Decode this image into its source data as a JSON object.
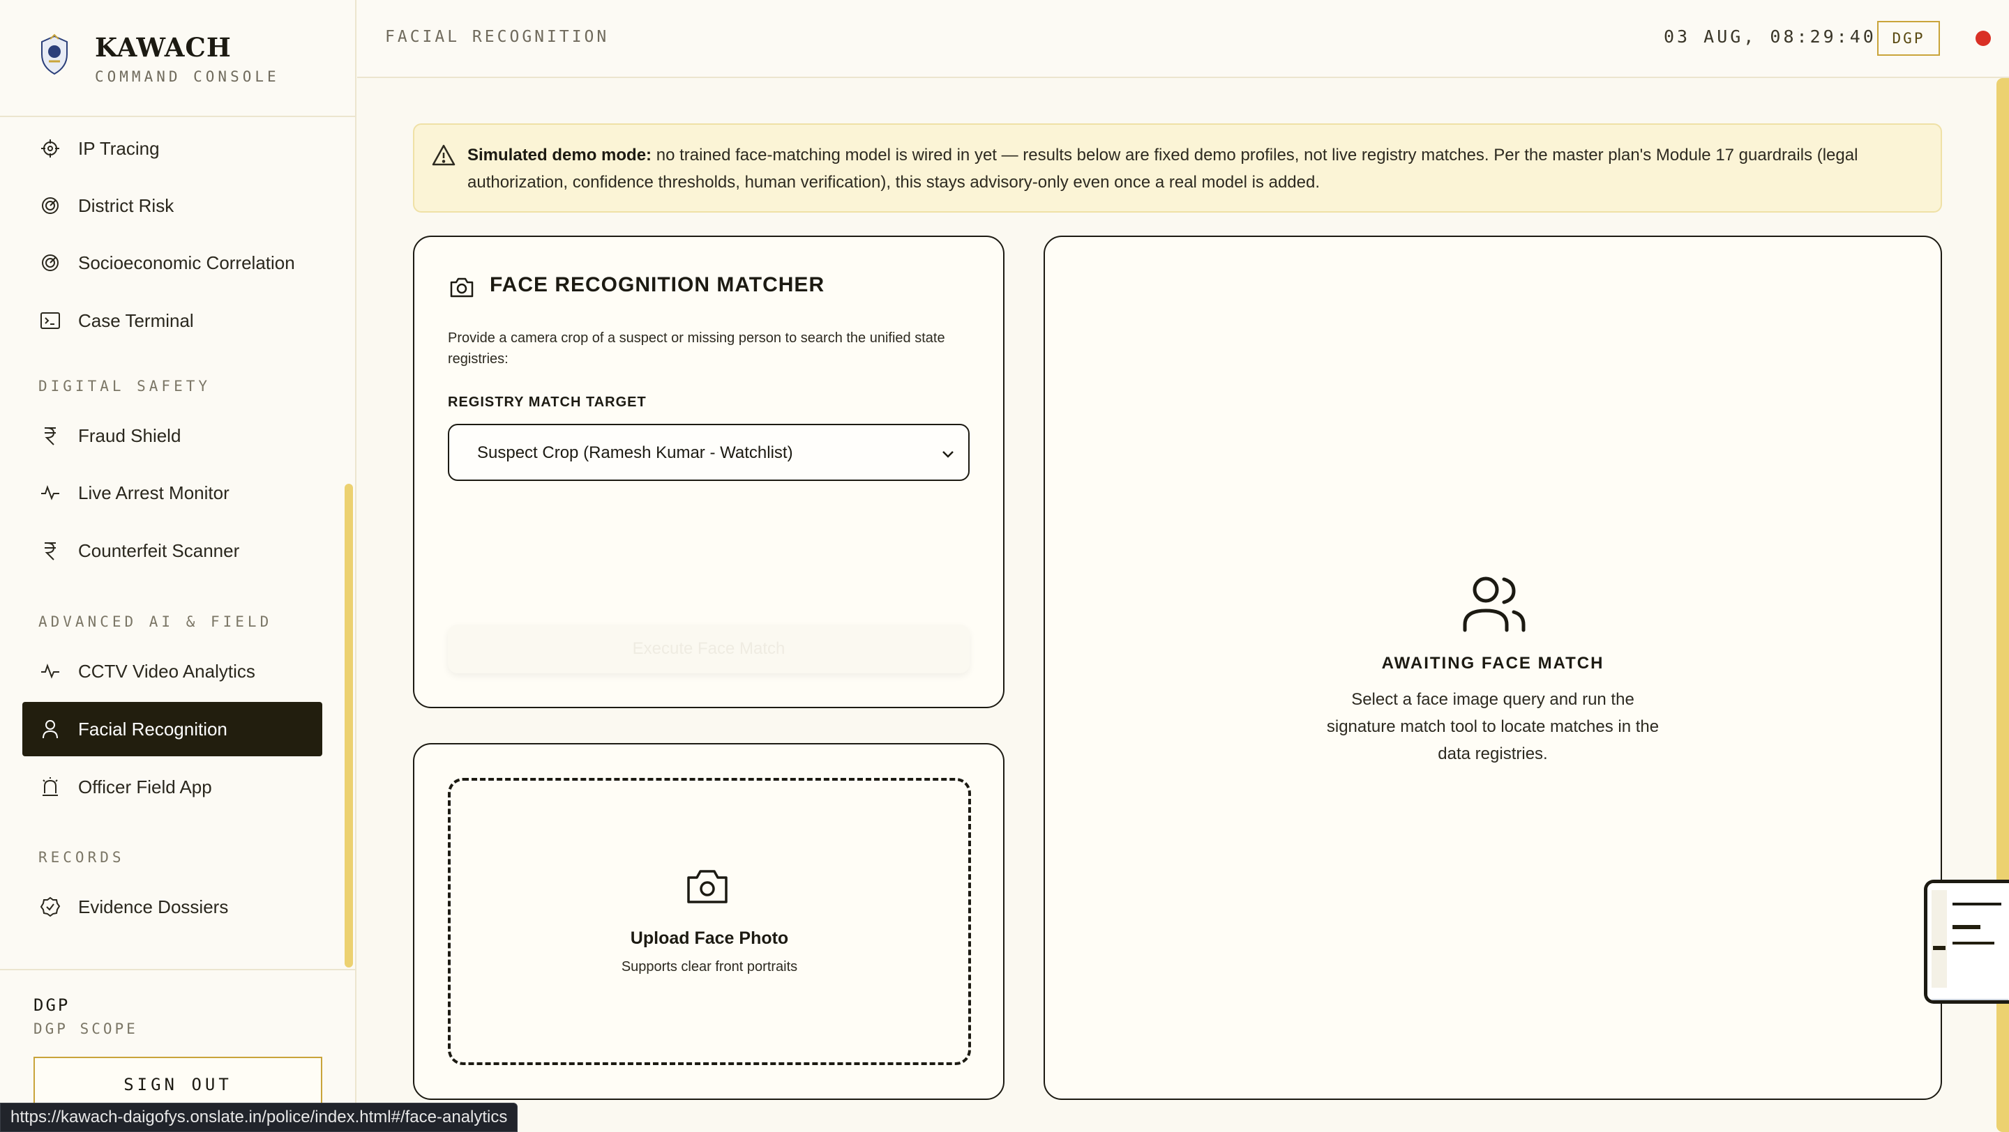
{
  "brand": {
    "title": "KAWACH",
    "subtitle": "COMMAND CONSOLE"
  },
  "nav": {
    "items_top": [
      {
        "label": "IP Tracing",
        "icon": "crosshair-icon"
      },
      {
        "label": "District Risk",
        "icon": "target-icon"
      },
      {
        "label": "Socioeconomic Correlation",
        "icon": "target-icon"
      },
      {
        "label": "Case Terminal",
        "icon": "terminal-icon"
      }
    ],
    "section_digital": "DIGITAL SAFETY",
    "items_digital": [
      {
        "label": "Fraud Shield",
        "icon": "rupee-icon"
      },
      {
        "label": "Live Arrest Monitor",
        "icon": "pulse-icon"
      },
      {
        "label": "Counterfeit Scanner",
        "icon": "rupee-icon"
      }
    ],
    "section_ai": "ADVANCED AI & FIELD",
    "items_ai": [
      {
        "label": "CCTV Video Analytics",
        "icon": "pulse-icon"
      },
      {
        "label": "Facial Recognition",
        "icon": "user-icon",
        "active": true
      },
      {
        "label": "Officer Field App",
        "icon": "siren-icon"
      }
    ],
    "section_records": "RECORDS",
    "items_records": [
      {
        "label": "Evidence Dossiers",
        "icon": "badge-check-icon"
      }
    ]
  },
  "user": {
    "name": "DGP",
    "scope": "DGP SCOPE",
    "signout_label": "SIGN OUT"
  },
  "status_url": "https://kawach-daigofys.onslate.in/police/index.html#/face-analytics",
  "topbar": {
    "title": "FACIAL RECOGNITION",
    "datetime": "03 AUG, 08:29:40",
    "role_badge": "DGP",
    "status_color": "#d93025"
  },
  "banner": {
    "lead": "Simulated demo mode:",
    "text": " no trained face-matching model is wired in yet — results below are fixed demo profiles, not live registry matches. Per the master plan's Module 17 guardrails (legal authorization, confidence thresholds, human verification), this stays advisory-only even once a real model is added."
  },
  "matcher": {
    "title": "FACE RECOGNITION MATCHER",
    "description": "Provide a camera crop of a suspect or missing person to search the unified state registries:",
    "target_label": "REGISTRY MATCH TARGET",
    "target_value": "Suspect Crop (Ramesh Kumar - Watchlist)",
    "run_label": "Execute Face Match"
  },
  "upload": {
    "title": "Upload Face Photo",
    "subtitle": "Supports clear front portraits"
  },
  "result": {
    "title": "AWAITING FACE MATCH",
    "description": "Select a face image query and run the signature match tool to locate matches in the data registries."
  },
  "colors": {
    "accent": "#ecd170",
    "active_nav": "#221e0e",
    "border_gold": "#c9a43a",
    "background": "#fbf9f1"
  }
}
